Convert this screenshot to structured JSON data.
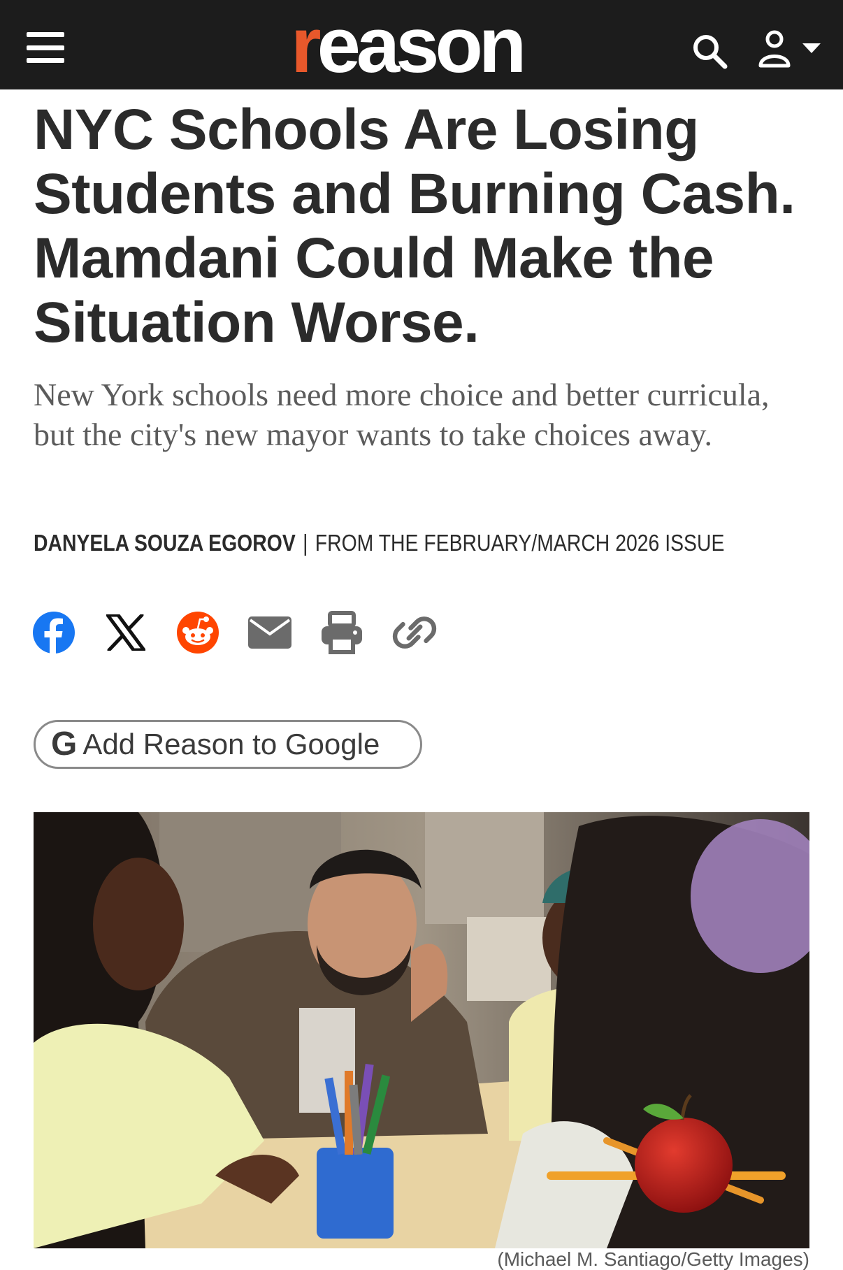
{
  "header": {
    "menu_icon": "hamburger-menu-icon",
    "logo_first": "r",
    "logo_rest": "eason",
    "search_icon": "search-icon",
    "user_icon": "user-account-icon",
    "colors": {
      "background": "#1c1c1c",
      "logo_accent": "#e8582b",
      "logo_text": "#ffffff"
    }
  },
  "article": {
    "headline": "NYC Schools Are Losing Students and Burning Cash. Mamdani Could Make the Situation Worse.",
    "dek": "New York schools need more choice and better curricula, but the city's new mayor wants to take choices away.",
    "author": "DANYELA SOUZA EGOROV",
    "separator": "|",
    "issue": "FROM THE FEBRUARY/MARCH 2026 ISSUE"
  },
  "share": [
    {
      "name": "facebook-icon",
      "color": "#1877f2"
    },
    {
      "name": "x-icon",
      "color": "#000000"
    },
    {
      "name": "reddit-icon",
      "color": "#ff4500"
    },
    {
      "name": "email-icon",
      "color": "#6b6b6b"
    },
    {
      "name": "print-icon",
      "color": "#6b6b6b"
    },
    {
      "name": "link-icon",
      "color": "#6b6b6b"
    }
  ],
  "google_button": {
    "icon_letter": "G",
    "label": "Add Reason to Google"
  },
  "photo": {
    "caption": "(Michael M. Santiago/Getty Images)"
  }
}
